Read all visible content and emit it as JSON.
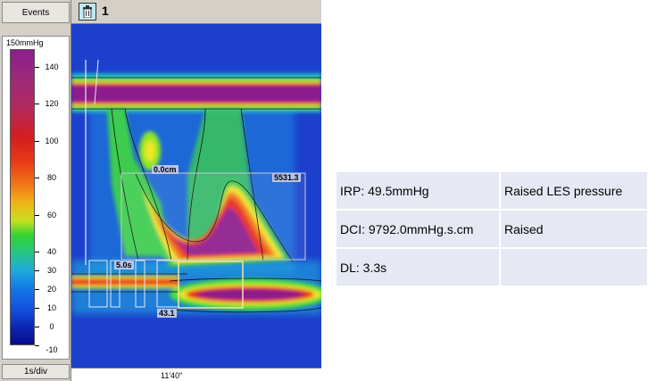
{
  "left_panel": {
    "events_label": "Events",
    "scale_max_label": "150mmHg",
    "scale_ticks": [
      "140",
      "120",
      "100",
      "80",
      "60",
      "40",
      "30",
      "20",
      "10",
      "0",
      "-10"
    ],
    "timebase_label": "1s/div"
  },
  "toolbar": {
    "trash_icon": "trash-icon",
    "channel_label": "1"
  },
  "plot": {
    "annotations": {
      "distance": "0.0cm",
      "dci_value": "5531.3",
      "duration": "5.0s",
      "depth": "43.1"
    },
    "time_label": "11'40\""
  },
  "results": {
    "rows": [
      {
        "measure": "IRP: 49.5mmHg",
        "interpretation": "Raised LES pressure"
      },
      {
        "measure": "DCI: 9792.0mmHg.s.cm",
        "interpretation": "Raised"
      },
      {
        "measure": "DL: 3.3s",
        "interpretation": ""
      }
    ]
  },
  "colors": {
    "panel_bg": "#d4d0c8",
    "plot_bg": "#1e46d2",
    "table_cell": "#e6e9f3"
  }
}
